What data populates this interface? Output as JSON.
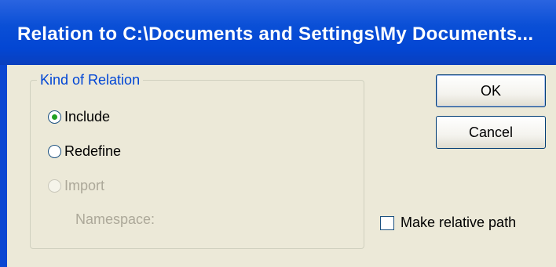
{
  "window": {
    "title": "Relation to C:\\Documents and Settings\\My Documents..."
  },
  "relation_group": {
    "legend": "Kind of Relation",
    "options": [
      {
        "label": "Include",
        "selected": true,
        "enabled": true
      },
      {
        "label": "Redefine",
        "selected": false,
        "enabled": true
      },
      {
        "label": "Import",
        "selected": false,
        "enabled": false
      }
    ],
    "namespace_label": "Namespace:"
  },
  "buttons": {
    "ok_label": "OK",
    "cancel_label": "Cancel"
  },
  "make_relative_path": {
    "label": "Make relative path",
    "checked": false
  },
  "colors": {
    "titlebar": "#0a4fd6",
    "dialog_face": "#ece9d8",
    "group_legend": "#0046d5",
    "radio_dot": "#21a121",
    "disabled_text": "#aca899"
  }
}
